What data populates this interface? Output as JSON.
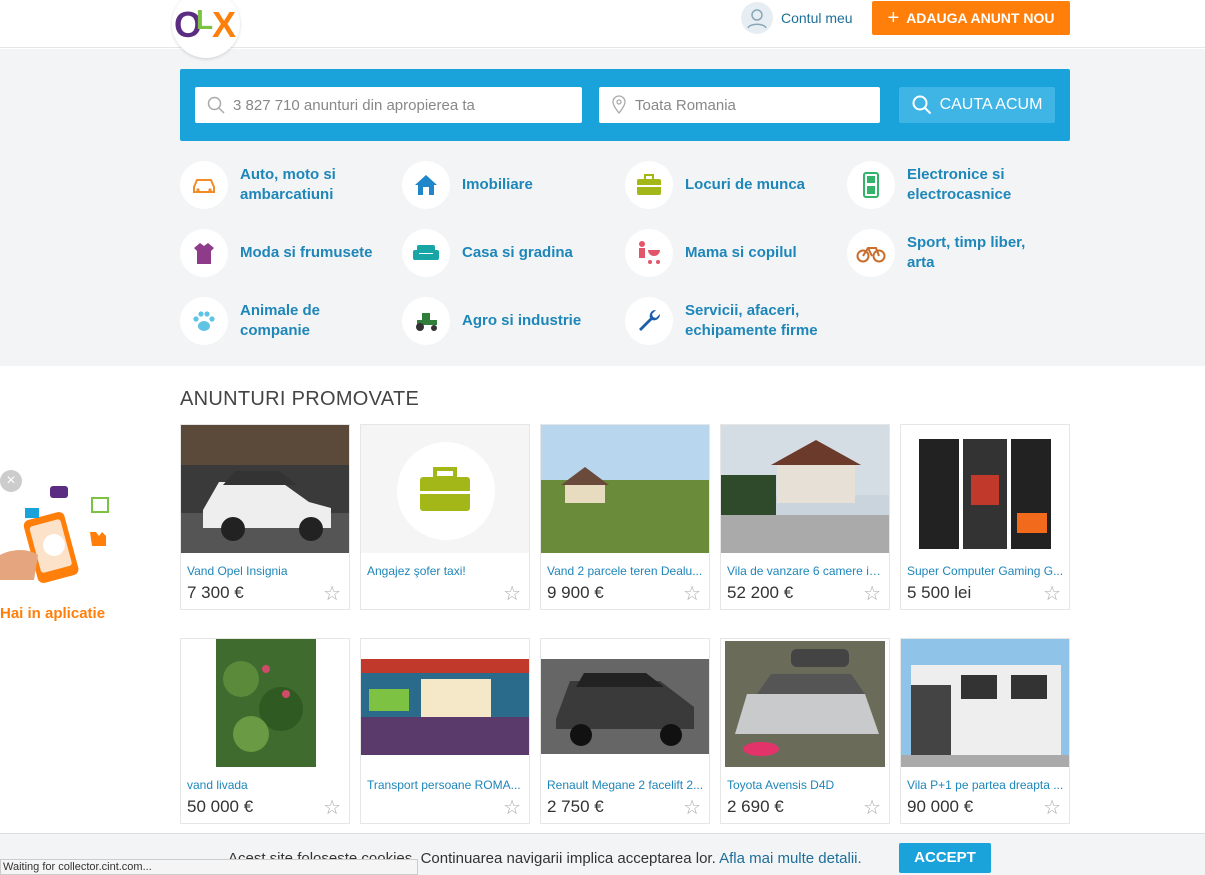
{
  "header": {
    "logo_letters": [
      "O",
      "L",
      "X"
    ],
    "account_label": "Contul meu",
    "post_button": "ADAUGA ANUNT NOU"
  },
  "search": {
    "query_placeholder": "3 827 710 anunturi din apropierea ta",
    "location_placeholder": "Toata Romania",
    "button": "CAUTA ACUM"
  },
  "categories": [
    {
      "label": "Auto, moto si ambarcatiuni",
      "icon": "car-icon"
    },
    {
      "label": "Imobiliare",
      "icon": "house-icon"
    },
    {
      "label": "Locuri de munca",
      "icon": "briefcase-icon"
    },
    {
      "label": "Electronice si electrocasnice",
      "icon": "phone-icon"
    },
    {
      "label": "Moda si frumusete",
      "icon": "clothes-icon"
    },
    {
      "label": "Casa si gradina",
      "icon": "sofa-icon"
    },
    {
      "label": "Mama si copilul",
      "icon": "stroller-icon"
    },
    {
      "label": "Sport, timp liber, arta",
      "icon": "bicycle-icon"
    },
    {
      "label": "Animale de companie",
      "icon": "paw-icon"
    },
    {
      "label": "Agro si industrie",
      "icon": "tractor-icon"
    },
    {
      "label": "Servicii, afaceri, echipamente firme",
      "icon": "wrench-icon"
    }
  ],
  "promoted": {
    "title": "ANUNTURI PROMOVATE",
    "items": [
      {
        "title": "Vand Opel Insignia",
        "price": "7 300 €"
      },
      {
        "title": "Angajez şofer taxi!",
        "price": ""
      },
      {
        "title": "Vand 2 parcele teren Dealu...",
        "price": "9 900 €"
      },
      {
        "title": "Vila de vanzare 6 camere in...",
        "price": "52 200 €"
      },
      {
        "title": "Super Computer Gaming G...",
        "price": "5 500 lei"
      },
      {
        "title": "vand livada",
        "price": "50 000 €"
      },
      {
        "title": "Transport persoane ROMA...",
        "price": ""
      },
      {
        "title": "Renault Megane 2 facelift 2...",
        "price": "2 750 €"
      },
      {
        "title": "Toyota Avensis D4D",
        "price": "2 690 €"
      },
      {
        "title": "Vila P+1 pe partea dreapta ...",
        "price": "90 000 €"
      }
    ]
  },
  "app_promo": {
    "label": "Hai in aplicatie"
  },
  "cookie": {
    "text": "Acest site foloseste cookies. Continuarea navigarii implica acceptarea lor.",
    "link": "Afla mai multe detalii.",
    "accept": "ACCEPT"
  },
  "status_bar": "Waiting for collector.cint.com...",
  "colors": {
    "accent": "#1aa3da",
    "orange": "#ff7f0a",
    "link": "#1e86b9"
  }
}
